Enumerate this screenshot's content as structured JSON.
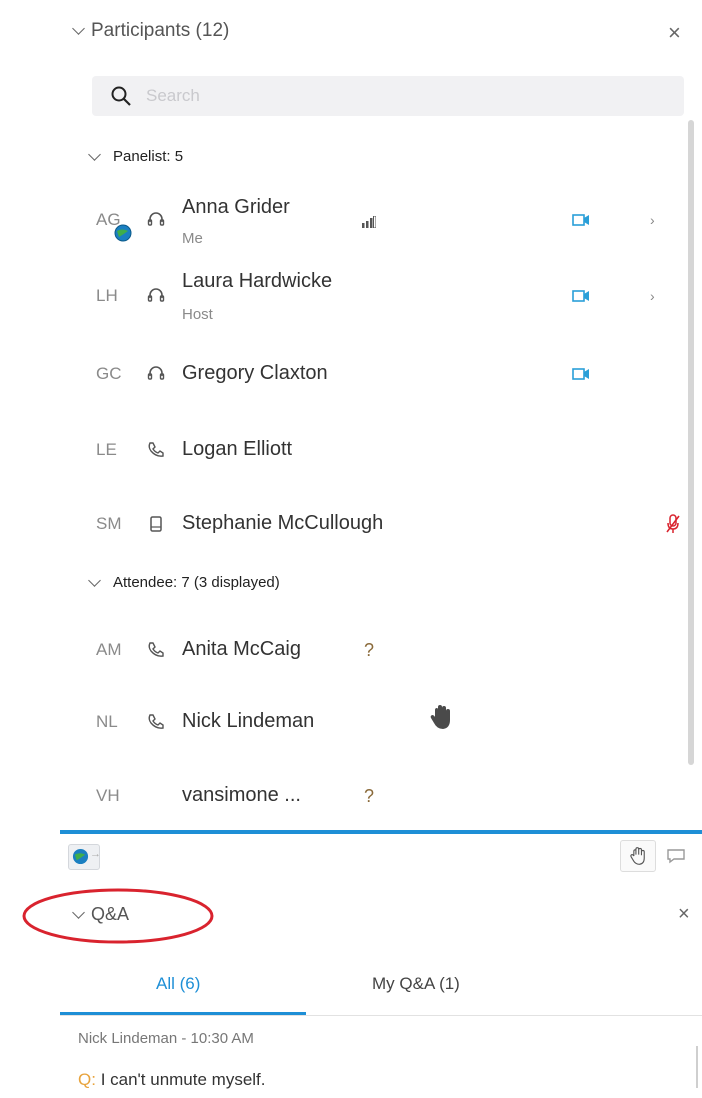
{
  "participants": {
    "title": "Participants (12)",
    "search_placeholder": "Search",
    "panelist_group": "Panelist: 5",
    "attendee_group": "Attendee: 7 (3 displayed)",
    "panelists": [
      {
        "initials": "AG",
        "name": "Anna Grider",
        "role": "Me"
      },
      {
        "initials": "LH",
        "name": "Laura Hardwicke",
        "role": "Host"
      },
      {
        "initials": "GC",
        "name": "Gregory Claxton",
        "role": ""
      },
      {
        "initials": "LE",
        "name": "Logan Elliott",
        "role": ""
      },
      {
        "initials": "SM",
        "name": "Stephanie McCullough",
        "role": ""
      }
    ],
    "attendees": [
      {
        "initials": "AM",
        "name": "Anita McCaig",
        "status": "?"
      },
      {
        "initials": "NL",
        "name": "Nick Lindeman",
        "status": ""
      },
      {
        "initials": "VH",
        "name": "vansimone ...",
        "status": "?"
      }
    ]
  },
  "qa": {
    "title": "Q&A",
    "tab_all": "All (6)",
    "tab_mine": "My Q&A (1)",
    "message_meta": "Nick Lindeman - 10:30 AM",
    "question_prefix": "Q:",
    "question_text": "I can't unmute myself."
  },
  "colors": {
    "accent": "#1e8fd6",
    "highlight_circle": "#d9232e",
    "muted_mic": "#d9232e",
    "question_prefix": "#e8a33c"
  }
}
